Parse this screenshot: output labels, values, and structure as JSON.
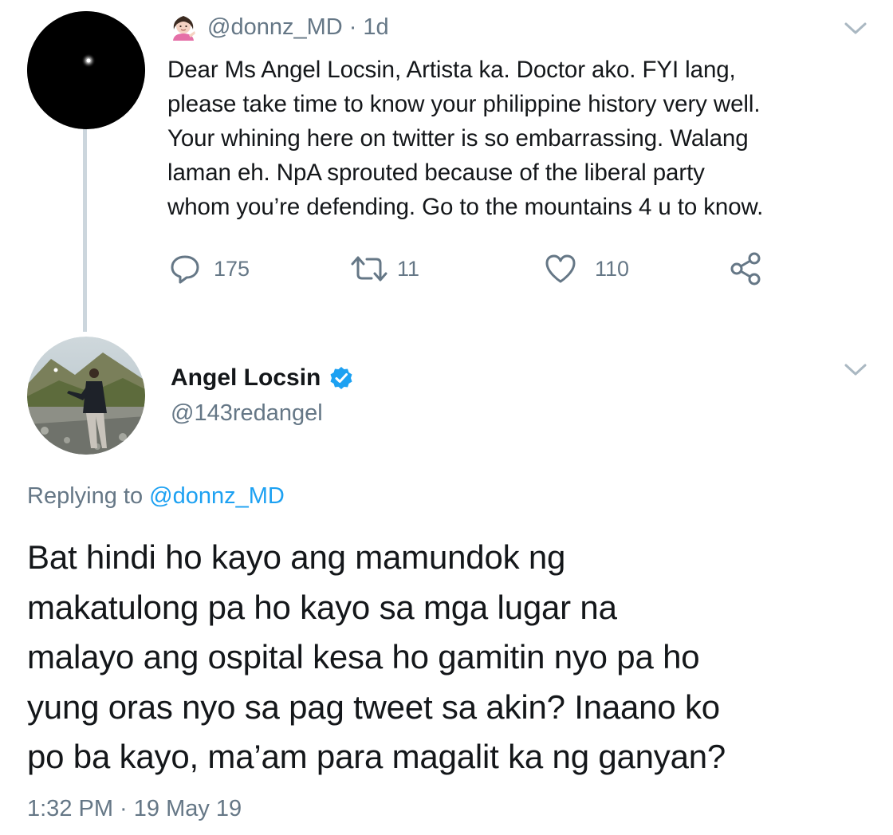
{
  "tweet_1": {
    "handle": "@donnz_MD",
    "separator": "·",
    "age": "1d",
    "avatar_icon": "night-sky-avatar-icon",
    "emoji_icon": "woman-tipping-hand-emoji-icon",
    "text": "Dear Ms Angel Locsin, Artista ka. Doctor ako. FYI lang,\nplease take time to know your philippine history very well.\nYour whining here on twitter is so embarrassing. Walang\nlaman eh. NpA sprouted because of the liberal party\nwhom you’re defending. Go to the mountains 4 u to know.",
    "actions": {
      "replies": "175",
      "retweets": "11",
      "likes": "110"
    }
  },
  "tweet_2": {
    "display_name": "Angel Locsin",
    "handle": "@143redangel",
    "verified_icon": "verified-badge-icon",
    "replying_prefix": "Replying to",
    "replying_mention": "@donnz_MD",
    "text": "Bat hindi ho kayo ang mamundok ng\nmakatulong pa ho kayo sa mga lugar na\nmalayo ang ospital kesa ho gamitin nyo pa ho\nyung oras nyo sa pag tweet sa akin? Inaano ko\npo ba kayo, ma’am para magalit ka ng ganyan?",
    "timestamp": "1:32 PM · 19 May 19"
  },
  "colors": {
    "secondary_text": "#657786",
    "link_blue": "#1da1f2",
    "primary_text": "#14171a",
    "thread_line": "#ccd6dd"
  }
}
